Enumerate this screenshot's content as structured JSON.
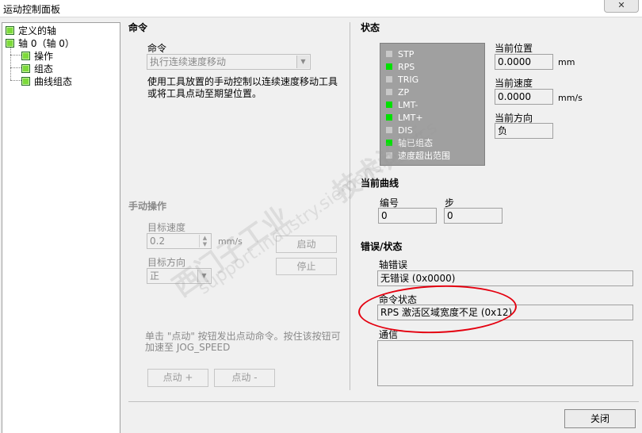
{
  "window": {
    "title": "运动控制面板"
  },
  "tree": [
    {
      "label": "定义的轴"
    },
    {
      "label": "轴 0（轴 0）"
    },
    {
      "label": "操作"
    },
    {
      "label": "组态"
    },
    {
      "label": "曲线组态"
    }
  ],
  "command": {
    "section_title": "命令",
    "label": "命令",
    "selected": "执行连续速度移动",
    "description_line1": "使用工具放置的手动控制以连续速度移动工具",
    "description_line2": "或将工具点动至期望位置。"
  },
  "manual": {
    "section_title": "手动操作",
    "target_speed_label": "目标速度",
    "target_speed_value": "0.2",
    "speed_unit": "mm/s",
    "target_dir_label": "目标方向",
    "target_dir_value": "正",
    "start_button": "启动",
    "stop_button": "停止",
    "hint_line1": "单击 \"点动\" 按钮发出点动命令。按住该按钮可",
    "hint_line2": "加速至 JOG_SPEED",
    "jog_plus": "点动 +",
    "jog_minus": "点动 -"
  },
  "status": {
    "section_title": "状态",
    "items": [
      {
        "label": "STP",
        "color": "#c8c8c8"
      },
      {
        "label": "RPS",
        "color": "#00e000"
      },
      {
        "label": "TRIG",
        "color": "#c8c8c8"
      },
      {
        "label": "ZP",
        "color": "#c8c8c8"
      },
      {
        "label": "LMT-",
        "color": "#00e000"
      },
      {
        "label": "LMT+",
        "color": "#00e000"
      },
      {
        "label": "DIS",
        "color": "#c8c8c8"
      },
      {
        "label": "轴已组态",
        "color": "#00e000"
      },
      {
        "label": "速度超出范围",
        "color": "#c8c8c8"
      }
    ],
    "position_label": "当前位置",
    "position_value": "0.0000",
    "position_unit": "mm",
    "speed_label": "当前速度",
    "speed_value": "0.0000",
    "speed_unit": "mm/s",
    "direction_label": "当前方向",
    "direction_value": "负"
  },
  "curve": {
    "section_title": "当前曲线",
    "number_label": "编号",
    "number_value": "0",
    "step_label": "步",
    "step_value": "0"
  },
  "errors": {
    "section_title": "错误/状态",
    "axis_error_label": "轴错误",
    "axis_error_value": "无错误 (0x0000)",
    "cmd_status_label": "命令状态",
    "cmd_status_value": "RPS 激活区域宽度不足 (0x12)",
    "comm_label": "通信",
    "comm_value": ""
  },
  "close_button": "关闭",
  "watermark": {
    "line1": "西门子工业",
    "line2": "技术论坛",
    "line3": "support.industry.siemens.com/cs"
  }
}
